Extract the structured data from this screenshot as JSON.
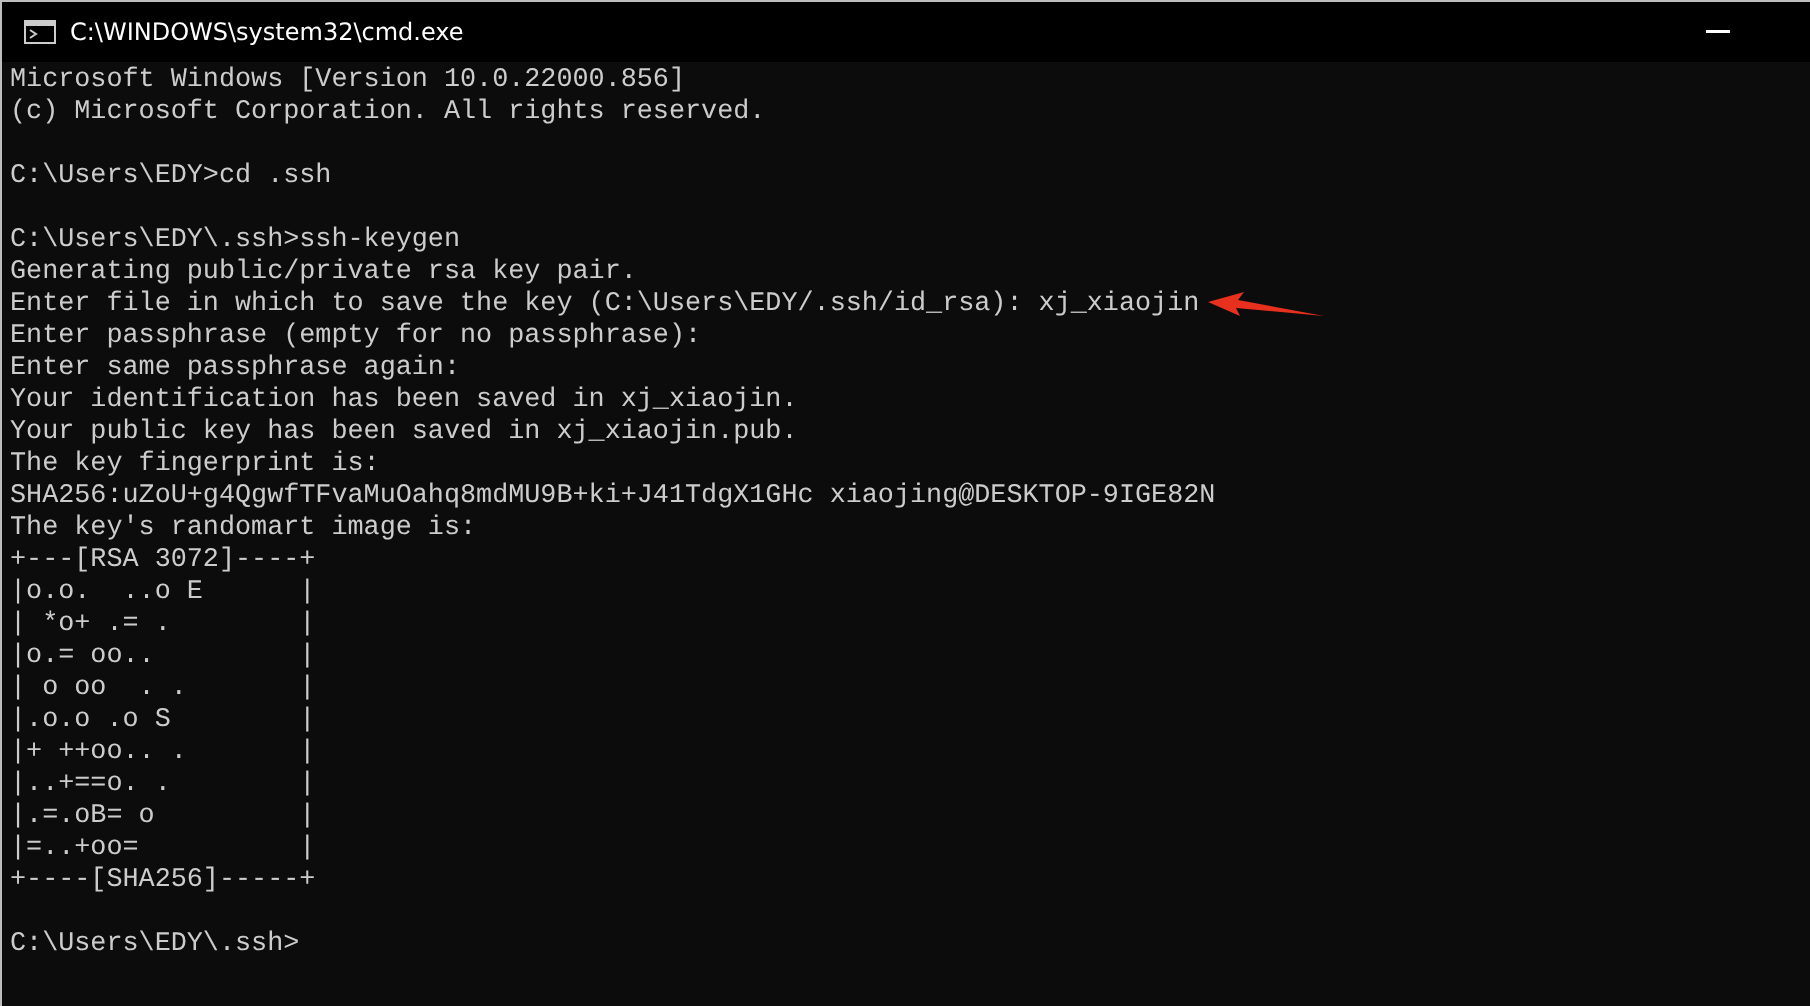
{
  "window": {
    "title": "C:\\WINDOWS\\system32\\cmd.exe"
  },
  "console": {
    "lines": [
      {
        "kind": "text",
        "text": "Microsoft Windows [Version 10.0.22000.856]"
      },
      {
        "kind": "text",
        "text": "(c) Microsoft Corporation. All rights reserved."
      },
      {
        "kind": "blank"
      },
      {
        "kind": "text",
        "text": "C:\\Users\\EDY>cd .ssh"
      },
      {
        "kind": "blank"
      },
      {
        "kind": "text",
        "text": "C:\\Users\\EDY\\.ssh>ssh-keygen"
      },
      {
        "kind": "text",
        "text": "Generating public/private rsa key pair."
      },
      {
        "kind": "text",
        "text": "Enter file in which to save the key (C:\\Users\\EDY/.ssh/id_rsa): xj_xiaojin",
        "arrow": true
      },
      {
        "kind": "text",
        "text": "Enter passphrase (empty for no passphrase):"
      },
      {
        "kind": "text",
        "text": "Enter same passphrase again:"
      },
      {
        "kind": "text",
        "text": "Your identification has been saved in xj_xiaojin."
      },
      {
        "kind": "text",
        "text": "Your public key has been saved in xj_xiaojin.pub."
      },
      {
        "kind": "text",
        "text": "The key fingerprint is:"
      },
      {
        "kind": "text",
        "text": "SHA256:uZoU+g4QgwfTFvaMuOahq8mdMU9B+ki+J41TdgX1GHc xiaojing@DESKTOP-9IGE82N"
      },
      {
        "kind": "text",
        "text": "The key's randomart image is:"
      },
      {
        "kind": "text",
        "text": "+---[RSA 3072]----+"
      },
      {
        "kind": "text",
        "text": "|o.o.  ..o E      |"
      },
      {
        "kind": "text",
        "text": "| *o+ .= .        |"
      },
      {
        "kind": "text",
        "text": "|o.= oo..         |"
      },
      {
        "kind": "text",
        "text": "| o oo  . .       |"
      },
      {
        "kind": "text",
        "text": "|.o.o .o S        |"
      },
      {
        "kind": "text",
        "text": "|+ ++oo.. .       |"
      },
      {
        "kind": "text",
        "text": "|..+==o. .        |"
      },
      {
        "kind": "text",
        "text": "|.=.oB= o         |"
      },
      {
        "kind": "text",
        "text": "|=..+oo=          |"
      },
      {
        "kind": "text",
        "text": "+----[SHA256]-----+"
      },
      {
        "kind": "blank"
      },
      {
        "kind": "text",
        "text": "C:\\Users\\EDY\\.ssh>"
      }
    ]
  }
}
